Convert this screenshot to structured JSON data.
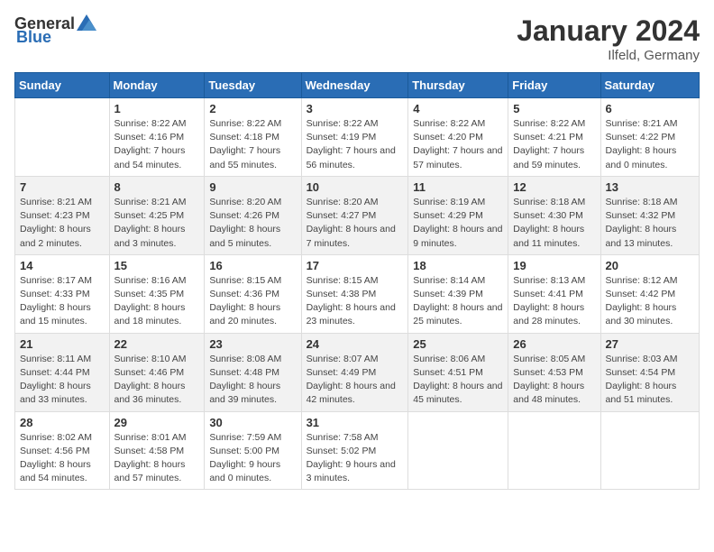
{
  "header": {
    "logo_general": "General",
    "logo_blue": "Blue",
    "month": "January 2024",
    "location": "Ilfeld, Germany"
  },
  "days_of_week": [
    "Sunday",
    "Monday",
    "Tuesday",
    "Wednesday",
    "Thursday",
    "Friday",
    "Saturday"
  ],
  "weeks": [
    [
      {
        "day": "",
        "sunrise": "",
        "sunset": "",
        "daylight": ""
      },
      {
        "day": "1",
        "sunrise": "Sunrise: 8:22 AM",
        "sunset": "Sunset: 4:16 PM",
        "daylight": "Daylight: 7 hours and 54 minutes."
      },
      {
        "day": "2",
        "sunrise": "Sunrise: 8:22 AM",
        "sunset": "Sunset: 4:18 PM",
        "daylight": "Daylight: 7 hours and 55 minutes."
      },
      {
        "day": "3",
        "sunrise": "Sunrise: 8:22 AM",
        "sunset": "Sunset: 4:19 PM",
        "daylight": "Daylight: 7 hours and 56 minutes."
      },
      {
        "day": "4",
        "sunrise": "Sunrise: 8:22 AM",
        "sunset": "Sunset: 4:20 PM",
        "daylight": "Daylight: 7 hours and 57 minutes."
      },
      {
        "day": "5",
        "sunrise": "Sunrise: 8:22 AM",
        "sunset": "Sunset: 4:21 PM",
        "daylight": "Daylight: 7 hours and 59 minutes."
      },
      {
        "day": "6",
        "sunrise": "Sunrise: 8:21 AM",
        "sunset": "Sunset: 4:22 PM",
        "daylight": "Daylight: 8 hours and 0 minutes."
      }
    ],
    [
      {
        "day": "7",
        "sunrise": "Sunrise: 8:21 AM",
        "sunset": "Sunset: 4:23 PM",
        "daylight": "Daylight: 8 hours and 2 minutes."
      },
      {
        "day": "8",
        "sunrise": "Sunrise: 8:21 AM",
        "sunset": "Sunset: 4:25 PM",
        "daylight": "Daylight: 8 hours and 3 minutes."
      },
      {
        "day": "9",
        "sunrise": "Sunrise: 8:20 AM",
        "sunset": "Sunset: 4:26 PM",
        "daylight": "Daylight: 8 hours and 5 minutes."
      },
      {
        "day": "10",
        "sunrise": "Sunrise: 8:20 AM",
        "sunset": "Sunset: 4:27 PM",
        "daylight": "Daylight: 8 hours and 7 minutes."
      },
      {
        "day": "11",
        "sunrise": "Sunrise: 8:19 AM",
        "sunset": "Sunset: 4:29 PM",
        "daylight": "Daylight: 8 hours and 9 minutes."
      },
      {
        "day": "12",
        "sunrise": "Sunrise: 8:18 AM",
        "sunset": "Sunset: 4:30 PM",
        "daylight": "Daylight: 8 hours and 11 minutes."
      },
      {
        "day": "13",
        "sunrise": "Sunrise: 8:18 AM",
        "sunset": "Sunset: 4:32 PM",
        "daylight": "Daylight: 8 hours and 13 minutes."
      }
    ],
    [
      {
        "day": "14",
        "sunrise": "Sunrise: 8:17 AM",
        "sunset": "Sunset: 4:33 PM",
        "daylight": "Daylight: 8 hours and 15 minutes."
      },
      {
        "day": "15",
        "sunrise": "Sunrise: 8:16 AM",
        "sunset": "Sunset: 4:35 PM",
        "daylight": "Daylight: 8 hours and 18 minutes."
      },
      {
        "day": "16",
        "sunrise": "Sunrise: 8:15 AM",
        "sunset": "Sunset: 4:36 PM",
        "daylight": "Daylight: 8 hours and 20 minutes."
      },
      {
        "day": "17",
        "sunrise": "Sunrise: 8:15 AM",
        "sunset": "Sunset: 4:38 PM",
        "daylight": "Daylight: 8 hours and 23 minutes."
      },
      {
        "day": "18",
        "sunrise": "Sunrise: 8:14 AM",
        "sunset": "Sunset: 4:39 PM",
        "daylight": "Daylight: 8 hours and 25 minutes."
      },
      {
        "day": "19",
        "sunrise": "Sunrise: 8:13 AM",
        "sunset": "Sunset: 4:41 PM",
        "daylight": "Daylight: 8 hours and 28 minutes."
      },
      {
        "day": "20",
        "sunrise": "Sunrise: 8:12 AM",
        "sunset": "Sunset: 4:42 PM",
        "daylight": "Daylight: 8 hours and 30 minutes."
      }
    ],
    [
      {
        "day": "21",
        "sunrise": "Sunrise: 8:11 AM",
        "sunset": "Sunset: 4:44 PM",
        "daylight": "Daylight: 8 hours and 33 minutes."
      },
      {
        "day": "22",
        "sunrise": "Sunrise: 8:10 AM",
        "sunset": "Sunset: 4:46 PM",
        "daylight": "Daylight: 8 hours and 36 minutes."
      },
      {
        "day": "23",
        "sunrise": "Sunrise: 8:08 AM",
        "sunset": "Sunset: 4:48 PM",
        "daylight": "Daylight: 8 hours and 39 minutes."
      },
      {
        "day": "24",
        "sunrise": "Sunrise: 8:07 AM",
        "sunset": "Sunset: 4:49 PM",
        "daylight": "Daylight: 8 hours and 42 minutes."
      },
      {
        "day": "25",
        "sunrise": "Sunrise: 8:06 AM",
        "sunset": "Sunset: 4:51 PM",
        "daylight": "Daylight: 8 hours and 45 minutes."
      },
      {
        "day": "26",
        "sunrise": "Sunrise: 8:05 AM",
        "sunset": "Sunset: 4:53 PM",
        "daylight": "Daylight: 8 hours and 48 minutes."
      },
      {
        "day": "27",
        "sunrise": "Sunrise: 8:03 AM",
        "sunset": "Sunset: 4:54 PM",
        "daylight": "Daylight: 8 hours and 51 minutes."
      }
    ],
    [
      {
        "day": "28",
        "sunrise": "Sunrise: 8:02 AM",
        "sunset": "Sunset: 4:56 PM",
        "daylight": "Daylight: 8 hours and 54 minutes."
      },
      {
        "day": "29",
        "sunrise": "Sunrise: 8:01 AM",
        "sunset": "Sunset: 4:58 PM",
        "daylight": "Daylight: 8 hours and 57 minutes."
      },
      {
        "day": "30",
        "sunrise": "Sunrise: 7:59 AM",
        "sunset": "Sunset: 5:00 PM",
        "daylight": "Daylight: 9 hours and 0 minutes."
      },
      {
        "day": "31",
        "sunrise": "Sunrise: 7:58 AM",
        "sunset": "Sunset: 5:02 PM",
        "daylight": "Daylight: 9 hours and 3 minutes."
      },
      {
        "day": "",
        "sunrise": "",
        "sunset": "",
        "daylight": ""
      },
      {
        "day": "",
        "sunrise": "",
        "sunset": "",
        "daylight": ""
      },
      {
        "day": "",
        "sunrise": "",
        "sunset": "",
        "daylight": ""
      }
    ]
  ]
}
